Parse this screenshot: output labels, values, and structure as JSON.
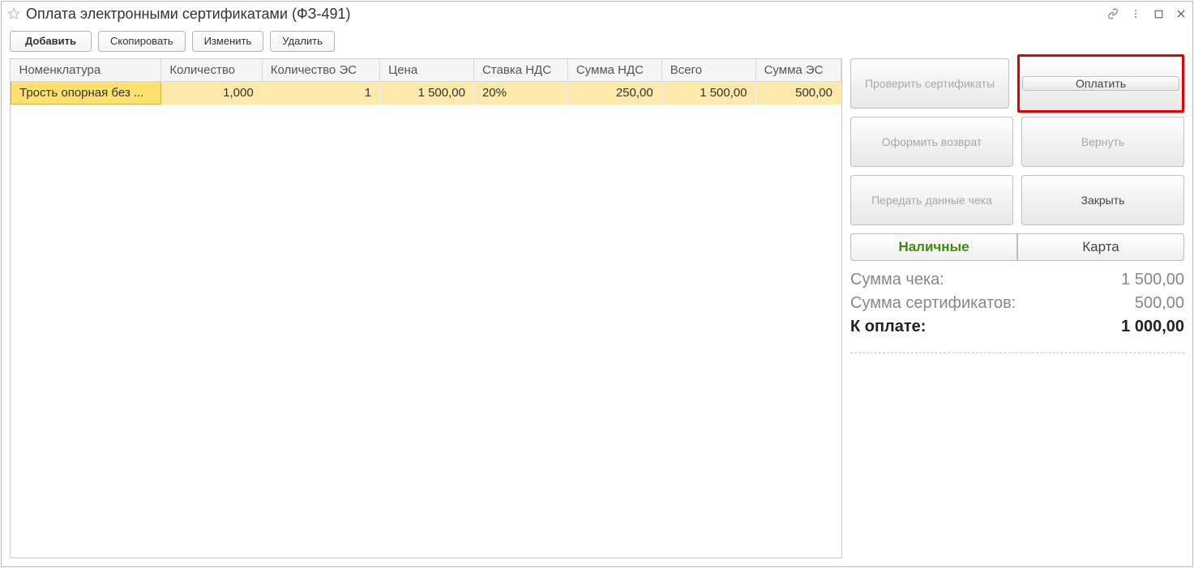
{
  "title": "Оплата электронными сертификатами (ФЗ-491)",
  "toolbar": {
    "add": "Добавить",
    "copy": "Скопировать",
    "edit": "Изменить",
    "delete": "Удалить"
  },
  "table": {
    "headers": {
      "nomenclature": "Номенклатура",
      "quantity": "Количество",
      "quantity_es": "Количество ЭС",
      "price": "Цена",
      "vat_rate": "Ставка НДС",
      "vat_sum": "Сумма НДС",
      "total": "Всего",
      "sum_es": "Сумма ЭС"
    },
    "rows": [
      {
        "nomenclature": "Трость опорная без ...",
        "quantity": "1,000",
        "quantity_es": "1",
        "price": "1 500,00",
        "vat_rate": "20%",
        "vat_sum": "250,00",
        "total": "1 500,00",
        "sum_es": "500,00"
      }
    ]
  },
  "buttons": {
    "check_certs": "Проверить сертификаты",
    "pay": "Оплатить",
    "issue_return": "Оформить возврат",
    "return": "Вернуть",
    "send_receipt": "Передать данные чека",
    "close": "Закрыть"
  },
  "toggle": {
    "cash": "Наличные",
    "card": "Карта"
  },
  "summary": {
    "receipt_label": "Сумма чека:",
    "receipt_value": "1 500,00",
    "certs_label": "Сумма сертификатов:",
    "certs_value": "500,00",
    "to_pay_label": "К оплате:",
    "to_pay_value": "1 000,00"
  }
}
